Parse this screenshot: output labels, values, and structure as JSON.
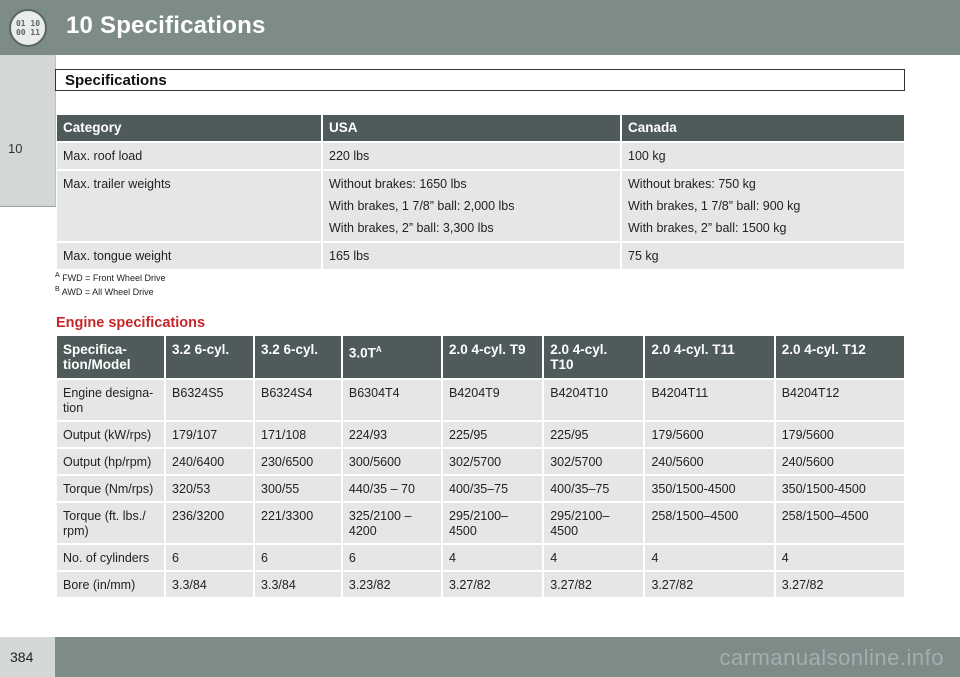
{
  "header": {
    "chapter_num": "10",
    "chapter_title": "Specifications",
    "badge_line1": "01 10",
    "badge_line2": "00 11"
  },
  "side_tab": {
    "label": "10"
  },
  "section": {
    "title": "Specifications"
  },
  "table1": {
    "headers": [
      "Category",
      "USA",
      "Canada"
    ],
    "rows": [
      {
        "category": "Max. roof load",
        "usa": [
          "220 lbs"
        ],
        "canada": [
          "100 kg"
        ]
      },
      {
        "category": "Max. trailer weights",
        "usa": [
          "Without brakes: 1650 lbs",
          "With brakes, 1 7/8” ball: 2,000 lbs",
          "With brakes, 2” ball: 3,300 lbs"
        ],
        "canada": [
          "Without brakes: 750 kg",
          "With brakes, 1 7/8” ball: 900 kg",
          "With brakes, 2” ball: 1500 kg"
        ]
      },
      {
        "category": "Max. tongue weight",
        "usa": [
          "165 lbs"
        ],
        "canada": [
          "75 kg"
        ]
      }
    ]
  },
  "footnotes": [
    {
      "mark": "A",
      "text": "FWD = Front Wheel Drive"
    },
    {
      "mark": "B",
      "text": "AWD = All Wheel Drive"
    }
  ],
  "engine": {
    "title": "Engine specifications",
    "headers": [
      {
        "text": "Specifica-\ntion/Model",
        "sup": ""
      },
      {
        "text": "3.2 6-cyl.",
        "sup": ""
      },
      {
        "text": "3.2 6-cyl.",
        "sup": ""
      },
      {
        "text": "3.0T",
        "sup": "A"
      },
      {
        "text": "2.0 4-cyl. T9",
        "sup": ""
      },
      {
        "text": "2.0 4-cyl.\nT10",
        "sup": ""
      },
      {
        "text": "2.0 4-cyl. T11",
        "sup": ""
      },
      {
        "text": "2.0 4-cyl. T12",
        "sup": ""
      }
    ],
    "rows": [
      [
        "Engine designa-\ntion",
        "B6324S5",
        "B6324S4",
        "B6304T4",
        "B4204T9",
        "B4204T10",
        "B4204T11",
        "B4204T12"
      ],
      [
        "Output (kW/rps)",
        "179/107",
        "171/108",
        "224/93",
        "225/95",
        "225/95",
        "179/5600",
        "179/5600"
      ],
      [
        "Output (hp/rpm)",
        "240/6400",
        "230/6500",
        "300/5600",
        "302/5700",
        "302/5700",
        "240/5600",
        "240/5600"
      ],
      [
        "Torque (Nm/rps)",
        "320/53",
        "300/55",
        "440/35 – 70",
        "400/35–75",
        "400/35–75",
        "350/1500-4500",
        "350/1500-4500"
      ],
      [
        "Torque (ft. lbs./\nrpm)",
        "236/3200",
        "221/3300",
        "325/2100 –\n  4200",
        "295/2100–\n4500",
        "295/2100–\n4500",
        "258/1500–4500",
        "258/1500–4500"
      ],
      [
        "No. of cylinders",
        "6",
        "6",
        "6",
        "4",
        "4",
        "4",
        "4"
      ],
      [
        "Bore (in/mm)",
        "3.3/84",
        "3.3/84",
        "3.23/82",
        "3.27/82",
        "3.27/82",
        "3.27/82",
        "3.27/82"
      ]
    ]
  },
  "footer": {
    "page_number": "384",
    "watermark": "carmanualsonline.info"
  }
}
